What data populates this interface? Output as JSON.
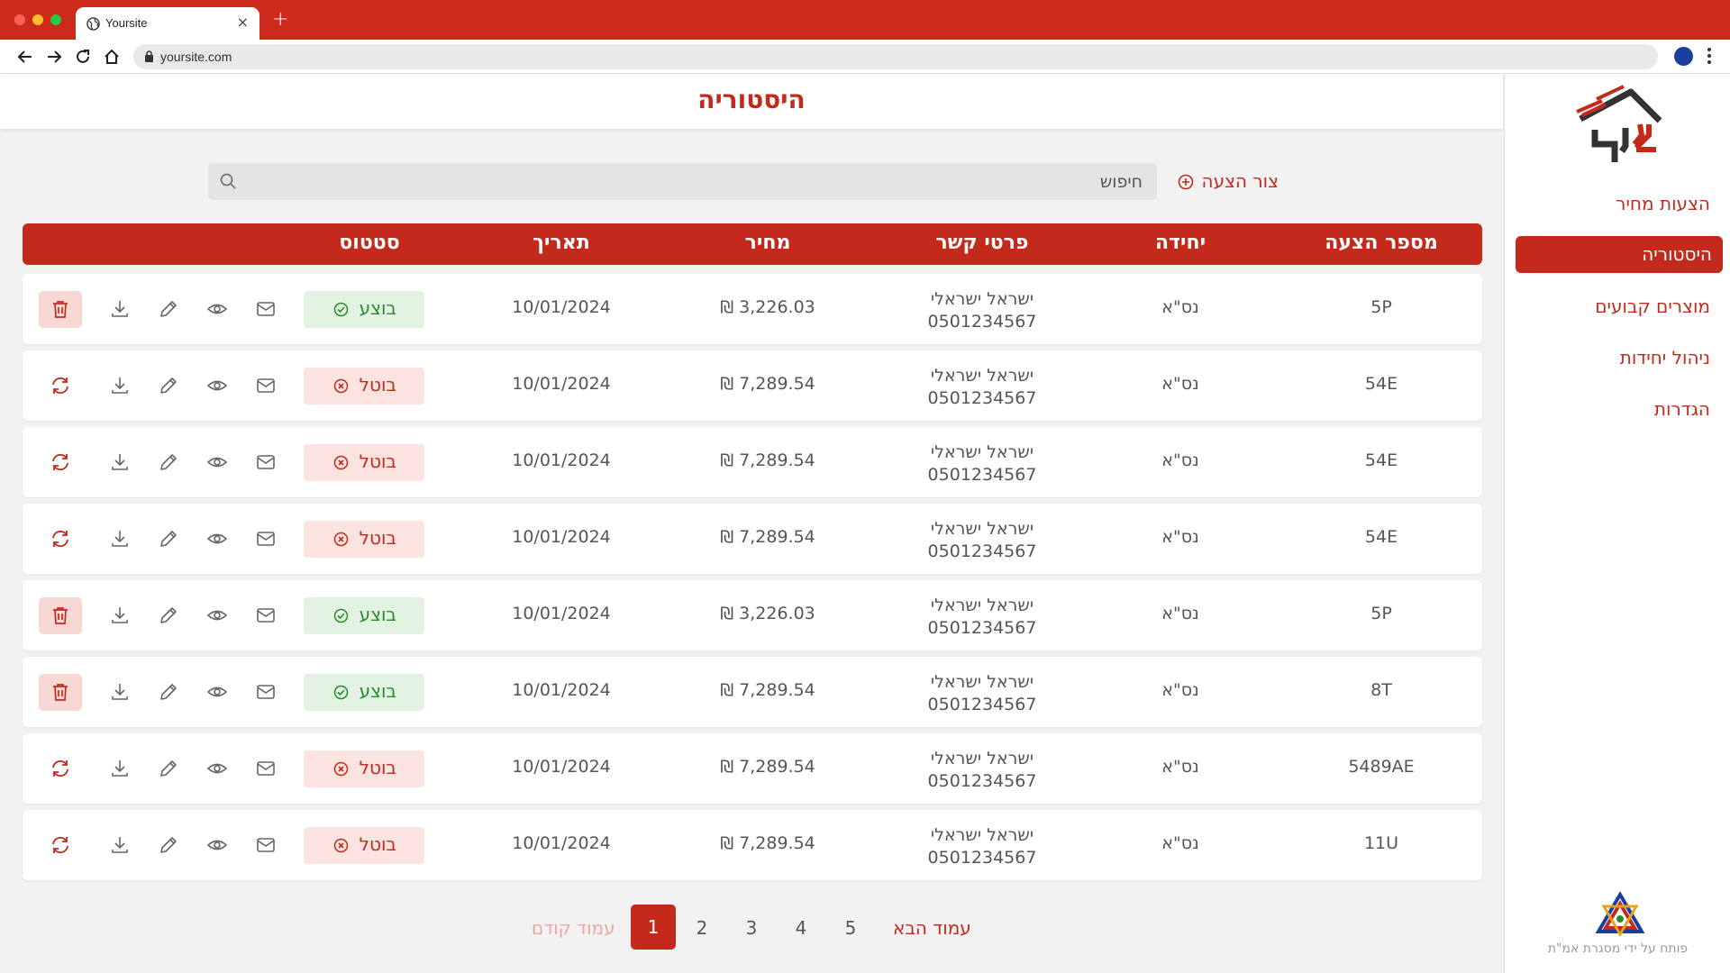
{
  "browser": {
    "tab_title": "Yoursite",
    "url": "yoursite.com",
    "new_tab_symbol": "+",
    "close_symbol": "×"
  },
  "sidebar": {
    "items": [
      {
        "label": "הצעות מחיר",
        "active": false
      },
      {
        "label": "היסטוריה",
        "active": true
      },
      {
        "label": "מוצרים קבועים",
        "active": false
      },
      {
        "label": "ניהול יחידות",
        "active": false
      },
      {
        "label": "הגדרות",
        "active": false
      }
    ],
    "footer": "פותח על ידי מסגרת אמ\"ת"
  },
  "header": {
    "title": "היסטוריה"
  },
  "toolbar": {
    "create_label": "צור הצעה",
    "search_placeholder": "חיפוש"
  },
  "table": {
    "columns": [
      "מספר הצעה",
      "יחידה",
      "פרטי קשר",
      "מחיר",
      "תאריך",
      "סטטוס"
    ],
    "rows": [
      {
        "number": "5P",
        "unit": "נס\"א",
        "contact_name": "ישראל ישראלי",
        "contact_phone": "0501234567",
        "price": "₪ 3,226.03",
        "date": "10/01/2024",
        "status": "בוצע",
        "status_type": "done"
      },
      {
        "number": "54E",
        "unit": "נס\"א",
        "contact_name": "ישראל ישראלי",
        "contact_phone": "0501234567",
        "price": "₪ 7,289.54",
        "date": "10/01/2024",
        "status": "בוטל",
        "status_type": "cancel"
      },
      {
        "number": "54E",
        "unit": "נס\"א",
        "contact_name": "ישראל ישראלי",
        "contact_phone": "0501234567",
        "price": "₪ 7,289.54",
        "date": "10/01/2024",
        "status": "בוטל",
        "status_type": "cancel"
      },
      {
        "number": "54E",
        "unit": "נס\"א",
        "contact_name": "ישראל ישראלי",
        "contact_phone": "0501234567",
        "price": "₪ 7,289.54",
        "date": "10/01/2024",
        "status": "בוטל",
        "status_type": "cancel"
      },
      {
        "number": "5P",
        "unit": "נס\"א",
        "contact_name": "ישראל ישראלי",
        "contact_phone": "0501234567",
        "price": "₪ 3,226.03",
        "date": "10/01/2024",
        "status": "בוצע",
        "status_type": "done"
      },
      {
        "number": "8T",
        "unit": "נס\"א",
        "contact_name": "ישראל ישראלי",
        "contact_phone": "0501234567",
        "price": "₪ 7,289.54",
        "date": "10/01/2024",
        "status": "בוצע",
        "status_type": "done"
      },
      {
        "number": "5489AE",
        "unit": "נס\"א",
        "contact_name": "ישראל ישראלי",
        "contact_phone": "0501234567",
        "price": "₪ 7,289.54",
        "date": "10/01/2024",
        "status": "בוטל",
        "status_type": "cancel"
      },
      {
        "number": "11U",
        "unit": "נס\"א",
        "contact_name": "ישראל ישראלי",
        "contact_phone": "0501234567",
        "price": "₪ 7,289.54",
        "date": "10/01/2024",
        "status": "בוטל",
        "status_type": "cancel"
      }
    ],
    "row_actions": [
      "mail-icon",
      "eye-icon",
      "pencil-icon",
      "download-icon",
      "trash-icon|refresh-icon"
    ]
  },
  "pagination": {
    "prev_label": "עמוד קודם",
    "next_label": "עמוד הבא",
    "pages": [
      "1",
      "2",
      "3",
      "4",
      "5"
    ],
    "current": "1"
  },
  "colors": {
    "brand_red": "#c42a1b",
    "success_green": "#2a8a2a",
    "success_bg": "#e3f3e3",
    "cancel_bg": "#fbe3e0"
  }
}
